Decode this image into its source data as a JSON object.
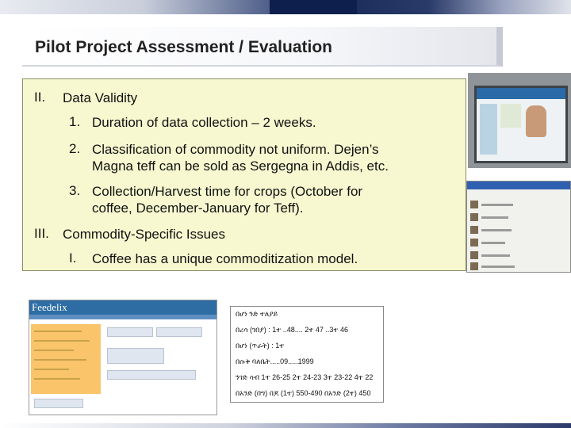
{
  "title": "Pilot Project Assessment / Evaluation",
  "sections": [
    {
      "numeral": "II.",
      "heading": "Data Validity",
      "items": [
        {
          "num": "1.",
          "lines": [
            "Duration of data collection – 2 weeks."
          ]
        },
        {
          "num": "2.",
          "lines": [
            "Classification of commodity not uniform. Dejen’s",
            "Magna teff can be sold as Sergegna in Addis, etc."
          ]
        },
        {
          "num": "3.",
          "lines": [
            "Collection/Harvest time for crops (October for",
            "coffee, December-January for Teff)."
          ]
        }
      ]
    },
    {
      "numeral": "III.",
      "heading": "Commodity-Specific Issues",
      "items": [
        {
          "num": "I.",
          "lines": [
            "Coffee has a unique commoditization model."
          ]
        }
      ]
    }
  ],
  "screenshots": {
    "feedelix_logo": "Feedelix",
    "amharic_lines": [
      "በሆነ ንድ ተለያይ",
      "በረሳ (ገበያ) : 1ተ ..48.... 2ተ 47 ..3ተ 46",
      "በሆነ (ጥራት) : 1ተ",
      "በሱቅ ባለቤት.....09.....1999",
      "ንገድ ሳብ 1ተ 26-25 2ተ 24-23 3ተ 23-22 4ተ 22",
      "በአንድ (በግ) በጆ (1ተ) 550-490 በአንድ (2ተ) 450"
    ]
  }
}
